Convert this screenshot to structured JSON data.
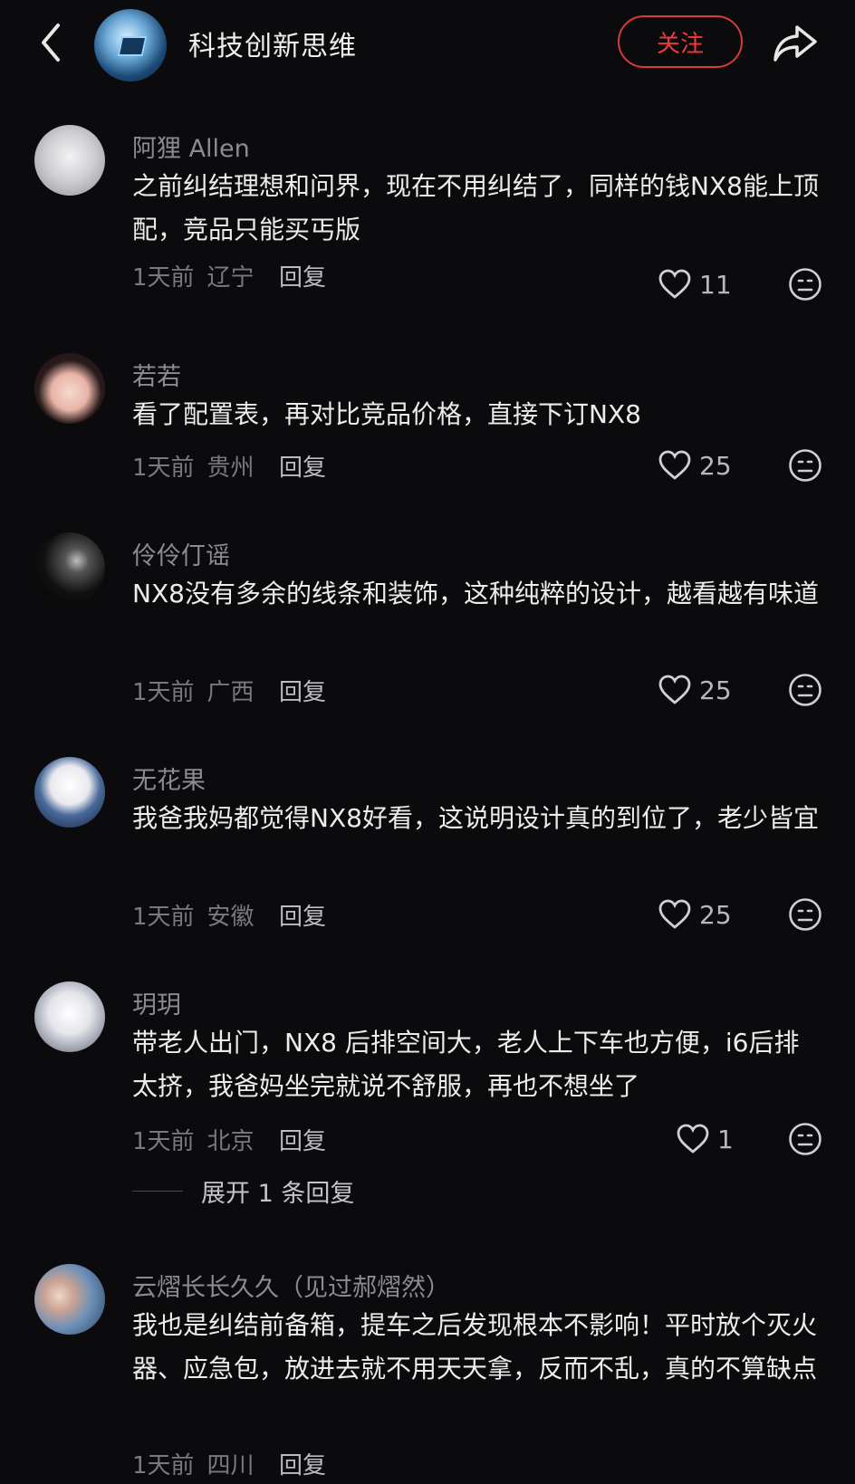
{
  "header": {
    "channel_name": "科技创新思维",
    "follow_label": "关注"
  },
  "comments": [
    {
      "user": "阿狸 Allen",
      "text": "之前纠结理想和问界，现在不用纠结了，同样的钱NX8能上顶配，竞品只能买丐版",
      "time": "1天前",
      "location": "辽宁",
      "reply": "回复",
      "likes": "11"
    },
    {
      "user": "若若",
      "text": "看了配置表，再对比竞品价格，直接下订NX8",
      "time": "1天前",
      "location": "贵州",
      "reply": "回复",
      "likes": "25"
    },
    {
      "user": "伶伶仃谣",
      "text": "NX8没有多余的线条和装饰，这种纯粹的设计，越看越有味道",
      "time": "1天前",
      "location": "广西",
      "reply": "回复",
      "likes": "25"
    },
    {
      "user": "无花果",
      "text": "我爸我妈都觉得NX8好看，这说明设计真的到位了，老少皆宜",
      "time": "1天前",
      "location": "安徽",
      "reply": "回复",
      "likes": "25"
    },
    {
      "user": "玥玥",
      "text": "带老人出门，NX8 后排空间大，老人上下车也方便，i6后排太挤，我爸妈坐完就说不舒服，再也不想坐了",
      "time": "1天前",
      "location": "北京",
      "reply": "回复",
      "likes": "1",
      "expand": "展开 1 条回复"
    },
    {
      "user": "云熠长长久久（见过郝熠然）",
      "text": "我也是纠结前备箱，提车之后发现根本不影响！平时放个灭火器、应急包，放进去就不用天天拿，反而不乱，真的不算缺点",
      "time": "1天前",
      "location": "四川",
      "reply": "回复"
    }
  ],
  "colors": {
    "background": "#0b0b0d",
    "accent": "#f0393c",
    "secondary_text": "#8c8c90"
  }
}
